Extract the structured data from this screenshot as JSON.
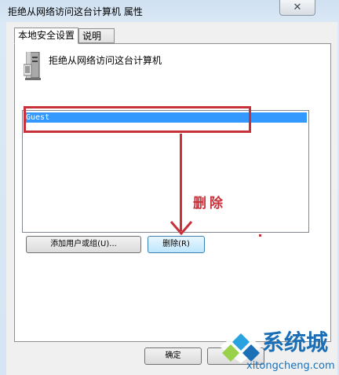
{
  "window": {
    "title": "拒绝从网络访问这台计算机 属性",
    "close_glyph": "✕"
  },
  "tabs": [
    {
      "label": "本地安全设置",
      "active": true
    },
    {
      "label": "说明",
      "active": false
    }
  ],
  "policy": {
    "icon": "server-computer-icon",
    "title": "拒绝从网络访问这台计算机"
  },
  "list": {
    "items": [
      {
        "label": "Guest",
        "selected": true
      }
    ]
  },
  "buttons": {
    "add_user": "添加用户或组(U)...",
    "remove": "删除(R)",
    "ok": "确定",
    "cancel": "取"
  },
  "annotation": {
    "text": "删除",
    "color": "#c8303a"
  },
  "watermark": {
    "name": "系统城",
    "url": "xitongcheng.com"
  },
  "colors": {
    "selection": "#3399ff",
    "title_gradient_top": "#cfe0f1"
  }
}
